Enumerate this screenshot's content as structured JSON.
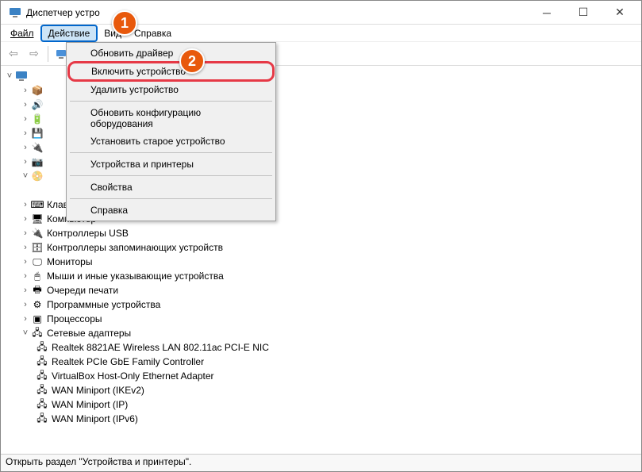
{
  "titlebar": {
    "title": "Диспетчер устро"
  },
  "menubar": {
    "file": "Файл",
    "action": "Действие",
    "view": "Вид",
    "help": "Справка"
  },
  "dropdown": {
    "update_driver": "Обновить драйвер",
    "enable_device": "Включить устройство",
    "remove_device": "Удалить устройство",
    "scan_hardware": "Обновить конфигурацию оборудования",
    "add_legacy": "Установить старое устройство",
    "devices_printers": "Устройства и принтеры",
    "properties": "Свойства",
    "help": "Справка"
  },
  "tree": {
    "root_icon": "computer",
    "visible_partial_rows": 8,
    "items": [
      {
        "label": "Клавиатуры",
        "icon": "keyboard"
      },
      {
        "label": "Компьютер",
        "icon": "computer"
      },
      {
        "label": "Контроллеры USB",
        "icon": "usb"
      },
      {
        "label": "Контроллеры запоминающих устройств",
        "icon": "storage"
      },
      {
        "label": "Мониторы",
        "icon": "monitor"
      },
      {
        "label": "Мыши и иные указывающие устройства",
        "icon": "mouse"
      },
      {
        "label": "Очереди печати",
        "icon": "printer"
      },
      {
        "label": "Программные устройства",
        "icon": "software"
      },
      {
        "label": "Процессоры",
        "icon": "cpu"
      }
    ],
    "network": {
      "label": "Сетевые адаптеры",
      "icon": "network",
      "children": [
        "Realtek 8821AE Wireless LAN 802.11ac PCI-E NIC",
        "Realtek PCIe GbE Family Controller",
        "VirtualBox Host-Only Ethernet Adapter",
        "WAN Miniport (IKEv2)",
        "WAN Miniport (IP)",
        "WAN Miniport (IPv6)"
      ]
    }
  },
  "callouts": {
    "c1": "1",
    "c2": "2"
  },
  "statusbar": {
    "text": "Открыть раздел \"Устройства и принтеры\"."
  }
}
